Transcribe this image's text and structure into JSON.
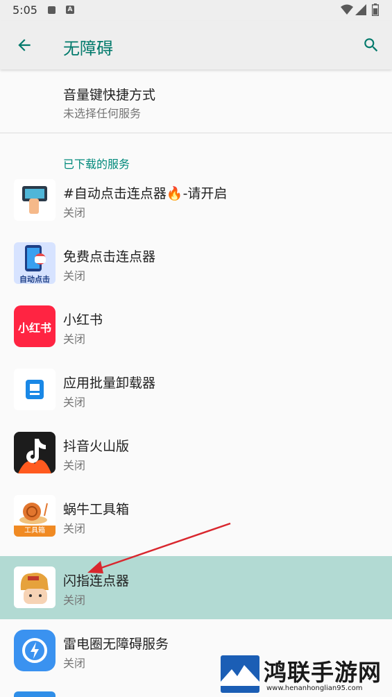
{
  "status_bar": {
    "time": "5:05",
    "notification_letter": "A"
  },
  "app_bar": {
    "title": "无障碍"
  },
  "shortcut": {
    "title": "音量键快捷方式",
    "subtitle": "未选择任何服务"
  },
  "section": {
    "header": "已下载的服务"
  },
  "services": [
    {
      "name": "#自动点击连点器🔥-请开启",
      "status": "关闭"
    },
    {
      "name": "免费点击连点器",
      "status": "关闭",
      "icon_text": "自动点击"
    },
    {
      "name": "小红书",
      "status": "关闭",
      "icon_text": "小红书"
    },
    {
      "name": "应用批量卸载器",
      "status": "关闭"
    },
    {
      "name": "抖音火山版",
      "status": "关闭"
    },
    {
      "name": "蜗牛工具箱",
      "status": "关闭",
      "icon_text": "工具箱"
    },
    {
      "name": "闪指连点器",
      "status": "关闭"
    },
    {
      "name": "雷电圈无障碍服务",
      "status": "关闭"
    }
  ],
  "watermark": {
    "title": "鸿联手游网",
    "url": "www.henanhonglian95.com"
  },
  "colors": {
    "accent": "#00796b",
    "highlight": "#b2dad3",
    "arrow": "#d9272e"
  }
}
